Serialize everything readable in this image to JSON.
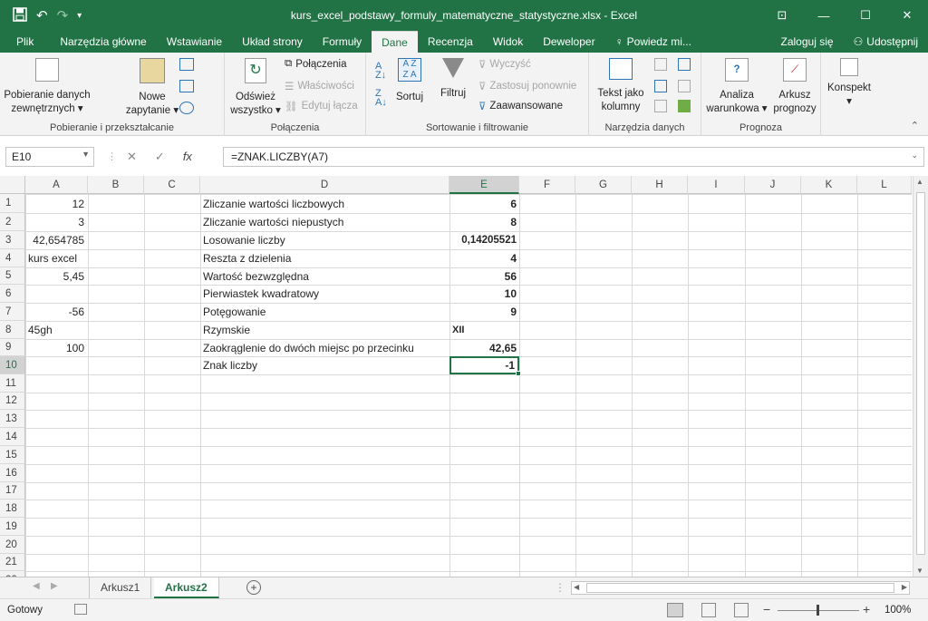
{
  "app": {
    "title": "kurs_excel_podstawy_formuly_matematyczne_statystyczne.xlsx - Excel",
    "accent": "#217346"
  },
  "quick_access": {
    "save_icon": "save-icon",
    "undo_icon": "undo-icon",
    "redo_icon": "redo-icon",
    "customize_icon": "customize-icon"
  },
  "window_buttons": [
    "ribbon-display-icon",
    "minimize-icon",
    "maximize-icon",
    "close-icon"
  ],
  "tabs": [
    {
      "label": "Plik"
    },
    {
      "label": "Narzędzia główne"
    },
    {
      "label": "Wstawianie"
    },
    {
      "label": "Układ strony"
    },
    {
      "label": "Formuły"
    },
    {
      "label": "Dane",
      "active": true
    },
    {
      "label": "Recenzja"
    },
    {
      "label": "Widok"
    },
    {
      "label": "Deweloper"
    },
    {
      "label": "Powiedz mi..."
    }
  ],
  "account": {
    "signin": "Zaloguj się",
    "share": "Udostępnij"
  },
  "ribbon": {
    "get_external": {
      "line1": "Pobieranie danych",
      "line2": "zewnętrznych ▾"
    },
    "new_query": {
      "line1": "Nowe",
      "line2": "zapytanie ▾"
    },
    "group1": "Pobieranie i przekształcanie",
    "refresh": {
      "line1": "Odśwież",
      "line2": "wszystko ▾"
    },
    "connections": "Połączenia",
    "properties": "Właściwości",
    "edit_links": "Edytuj łącza",
    "group2": "Połączenia",
    "sort": "Sortuj",
    "filter": "Filtruj",
    "clear": "Wyczyść",
    "reapply": "Zastosuj ponownie",
    "advanced": "Zaawansowane",
    "group3": "Sortowanie i filtrowanie",
    "text_to_columns": {
      "line1": "Tekst jako",
      "line2": "kolumny"
    },
    "group4": "Narzędzia danych",
    "what_if": {
      "line1": "Analiza",
      "line2": "warunkowa ▾"
    },
    "forecast": {
      "line1": "Arkusz",
      "line2": "prognozy"
    },
    "group5": "Prognoza",
    "outline": "Konspekt"
  },
  "formula_bar": {
    "name_box": "E10",
    "formula": "=ZNAK.LICZBY(A7)"
  },
  "columns": [
    "A",
    "B",
    "C",
    "D",
    "E",
    "F",
    "G",
    "H",
    "I",
    "J",
    "K",
    "L"
  ],
  "rows": [
    "1",
    "2",
    "3",
    "4",
    "5",
    "6",
    "7",
    "8",
    "9",
    "10",
    "11",
    "12",
    "13",
    "14",
    "15",
    "16",
    "17",
    "18",
    "19",
    "20",
    "21",
    "22"
  ],
  "cells": {
    "A1": "12",
    "A2": "3",
    "A3": "42,654785",
    "A4": "kurs  excel",
    "A5": "5,45",
    "A7": "-56",
    "A8": "45gh",
    "A9": "100",
    "D1": "Zliczanie wartości liczbowych",
    "D2": "Zliczanie wartości niepustych",
    "D3": "Losowanie liczby",
    "D4": "Reszta z dzielenia",
    "D5": "Wartość bezwzględna",
    "D6": "Pierwiastek kwadratowy",
    "D7": "Potęgowanie",
    "D8": "Rzymskie",
    "D9": "Zaokrąglenie do dwóch miejsc po przecinku",
    "D10": "Znak liczby",
    "E1": "6",
    "E2": "8",
    "E3": "0,14205521",
    "E4": "4",
    "E5": "56",
    "E6": "10",
    "E7": "9",
    "E8": "XII",
    "E9": "42,65",
    "E10": "-1"
  },
  "selected_cell": "E10",
  "sheets": [
    {
      "label": "Arkusz1"
    },
    {
      "label": "Arkusz2",
      "active": true
    }
  ],
  "status": {
    "ready": "Gotowy",
    "zoom": "100%"
  }
}
